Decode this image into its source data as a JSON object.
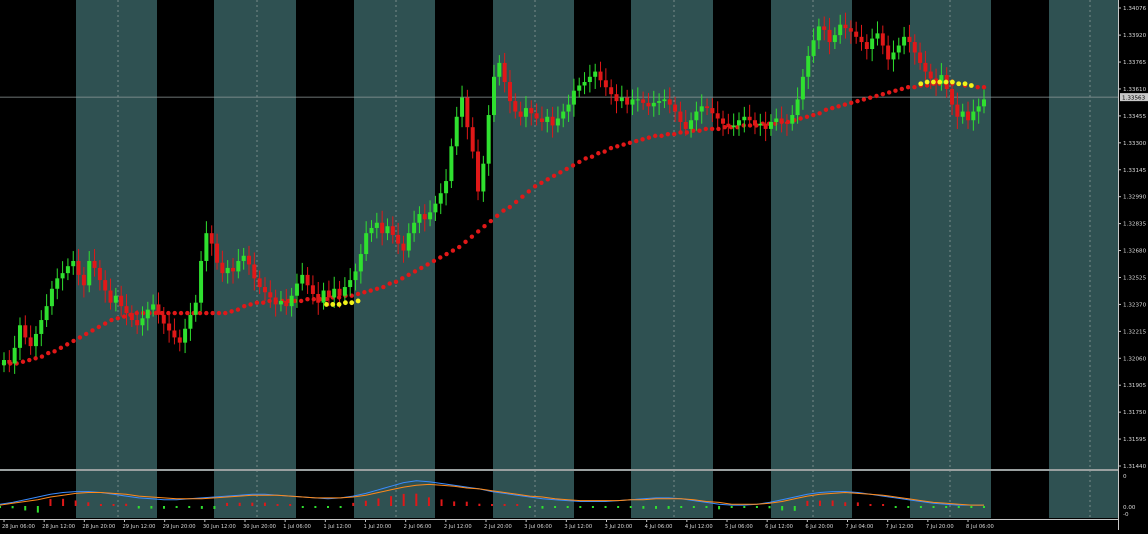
{
  "chart_data": {
    "type": "candlestick",
    "symbol_hint": "GBP/USD style FX chart",
    "colors": {
      "background": "#000000",
      "session_band": "#2f5152",
      "grid": "#9aa0a0",
      "bull_candle": "#2fe02f",
      "bear_candle": "#e01818",
      "ma_red": "#e01818",
      "ma_yellow": "#f2f21a",
      "price_line": "#8f9a9a",
      "axis_text": "#d8d8d8",
      "current_price_box": "#c8c8c8"
    },
    "price_axis": {
      "ylim": [
        1.3144,
        1.34076
      ],
      "tick_labels": [
        "1.34076",
        "1.33920",
        "1.33765",
        "1.33610",
        "1.33455",
        "1.33300",
        "1.33145",
        "1.32990",
        "1.32835",
        "1.32680",
        "1.32525",
        "1.32370",
        "1.32215",
        "1.32060",
        "1.31905",
        "1.31750",
        "1.31595",
        "1.31440"
      ],
      "tick_values": [
        1.34076,
        1.3392,
        1.33765,
        1.3361,
        1.33455,
        1.333,
        1.33145,
        1.3299,
        1.32835,
        1.3268,
        1.32525,
        1.3237,
        1.32215,
        1.3206,
        1.31905,
        1.3175,
        1.31595,
        1.3144
      ],
      "current_price": "1.33563"
    },
    "time_axis": {
      "tick_labels": [
        "28 Jun 06:00",
        "28 Jun 12:00",
        "28 Jun 20:00",
        "29 Jun 12:00",
        "29 Jun 20:00",
        "30 Jun 12:00",
        "30 Jun 20:00",
        "1 Jul 06:00",
        "1 Jul 12:00",
        "1 Jul 20:00",
        "2 Jul 06:00",
        "2 Jul 12:00",
        "2 Jul 20:00",
        "3 Jul 06:00",
        "3 Jul 12:00",
        "3 Jul 20:00",
        "4 Jul 06:00",
        "4 Jul 12:00",
        "5 Jul 06:00",
        "6 Jul 12:00",
        "6 Jul 20:00",
        "7 Jul 04:00",
        "7 Jul 12:00",
        "7 Jul 20:00",
        "8 Jul 06:00"
      ]
    },
    "indicator_axis": {
      "tick_labels": [
        "0",
        "0.00",
        "-0"
      ]
    },
    "candles_close": [
      1.3205,
      1.3203,
      1.3212,
      1.3225,
      1.3218,
      1.3213,
      1.322,
      1.3228,
      1.3236,
      1.3246,
      1.3252,
      1.3255,
      1.3259,
      1.3262,
      1.3254,
      1.3248,
      1.3262,
      1.3258,
      1.3251,
      1.3245,
      1.3238,
      1.3242,
      1.3236,
      1.3232,
      1.3228,
      1.3225,
      1.3229,
      1.3234,
      1.3237,
      1.3231,
      1.3226,
      1.3222,
      1.3218,
      1.3215,
      1.3223,
      1.3231,
      1.3238,
      1.3262,
      1.3278,
      1.3272,
      1.3261,
      1.3255,
      1.3258,
      1.3256,
      1.3262,
      1.3265,
      1.326,
      1.3252,
      1.3247,
      1.3244,
      1.3241,
      1.3237,
      1.3239,
      1.3236,
      1.3242,
      1.3249,
      1.3254,
      1.3248,
      1.3243,
      1.3238,
      1.3245,
      1.3241,
      1.3246,
      1.3242,
      1.3247,
      1.3251,
      1.3256,
      1.3266,
      1.3278,
      1.3281,
      1.3284,
      1.3278,
      1.3282,
      1.3277,
      1.3272,
      1.3268,
      1.3278,
      1.3284,
      1.3289,
      1.3286,
      1.329,
      1.3295,
      1.3301,
      1.3308,
      1.3328,
      1.3345,
      1.3356,
      1.3339,
      1.3325,
      1.3302,
      1.3318,
      1.3346,
      1.3368,
      1.3376,
      1.3365,
      1.3354,
      1.3348,
      1.3345,
      1.335,
      1.3347,
      1.3344,
      1.3342,
      1.3345,
      1.334,
      1.3344,
      1.3348,
      1.3352,
      1.336,
      1.3363,
      1.3365,
      1.3368,
      1.3371,
      1.3366,
      1.3362,
      1.3358,
      1.3354,
      1.3356,
      1.3352,
      1.3355,
      1.3355,
      1.3353,
      1.3351,
      1.3353,
      1.3354,
      1.3355,
      1.3352,
      1.3348,
      1.3342,
      1.3338,
      1.3343,
      1.3348,
      1.3351,
      1.335,
      1.3347,
      1.3344,
      1.3341,
      1.3339,
      1.334,
      1.3343,
      1.3345,
      1.3343,
      1.334,
      1.3341,
      1.3338,
      1.3342,
      1.3344,
      1.3342,
      1.3341,
      1.3346,
      1.3355,
      1.3368,
      1.338,
      1.3389,
      1.3397,
      1.3395,
      1.3388,
      1.3392,
      1.3398,
      1.3396,
      1.3394,
      1.3391,
      1.3388,
      1.3384,
      1.339,
      1.3393,
      1.3386,
      1.3378,
      1.3382,
      1.3386,
      1.3391,
      1.3388,
      1.3382,
      1.3376,
      1.3371,
      1.3367,
      1.3364,
      1.3369,
      1.3361,
      1.3352,
      1.3345,
      1.3348,
      1.3343,
      1.3348,
      1.3351,
      1.3355
    ],
    "ma_red": [
      1.3203,
      1.3203,
      1.3203,
      1.3204,
      1.3205,
      1.3206,
      1.3207,
      1.3209,
      1.321,
      1.3212,
      1.3214,
      1.3216,
      1.3218,
      1.322,
      1.3222,
      1.3224,
      1.3226,
      1.3228,
      1.3229,
      1.323,
      1.3231,
      1.3232,
      1.3232,
      1.3232,
      1.3232,
      1.3232,
      1.3232,
      1.3232,
      1.3232,
      1.3232,
      1.3232,
      1.3232,
      1.3232,
      1.3232,
      1.3232,
      1.3232,
      1.3233,
      1.3234,
      1.3236,
      1.3237,
      1.3238,
      1.3238,
      1.3239,
      1.3239,
      1.3239,
      1.3239,
      1.3239,
      1.3239,
      1.324,
      1.324,
      1.324,
      1.324,
      1.3241,
      1.3241,
      1.3242,
      1.3242,
      1.3243,
      1.3244,
      1.3245,
      1.3246,
      1.3247,
      1.3249,
      1.325,
      1.3252,
      1.3254,
      1.3256,
      1.3258,
      1.326,
      1.3262,
      1.3264,
      1.3266,
      1.3268,
      1.327,
      1.3273,
      1.3276,
      1.3279,
      1.3282,
      1.3285,
      1.3288,
      1.3291,
      1.3293,
      1.3296,
      1.3299,
      1.3302,
      1.3305,
      1.3307,
      1.3309,
      1.3311,
      1.3313,
      1.3315,
      1.3317,
      1.3319,
      1.3321,
      1.3322,
      1.3324,
      1.3325,
      1.3327,
      1.3328,
      1.3329,
      1.333,
      1.3331,
      1.3332,
      1.3333,
      1.3334,
      1.3334,
      1.3335,
      1.3335,
      1.3336,
      1.3336,
      1.3337,
      1.3337,
      1.3338,
      1.3338,
      1.3338,
      1.3339,
      1.3339,
      1.3339,
      1.334,
      1.334,
      1.334,
      1.3341,
      1.3341,
      1.3341,
      1.3342,
      1.3342,
      1.3343,
      1.3344,
      1.3345,
      1.3346,
      1.3347,
      1.3349,
      1.335,
      1.3351,
      1.3352,
      1.3353,
      1.3354,
      1.3355,
      1.3356,
      1.3357,
      1.3358,
      1.3359,
      1.336,
      1.3361,
      1.3362,
      1.3362,
      1.3363,
      1.3363,
      1.3364,
      1.3364,
      1.3364,
      1.3364,
      1.3364,
      1.3363,
      1.3363,
      1.3362,
      1.3362
    ],
    "ma_yellow_segments": [
      {
        "start": 51,
        "values": [
          1.3237,
          1.3237,
          1.3237,
          1.3238,
          1.3238,
          1.3239
        ]
      },
      {
        "start": 145,
        "values": [
          1.3364,
          1.3365,
          1.3365,
          1.3365,
          1.3365,
          1.3365,
          1.3364,
          1.3364,
          1.3363
        ]
      }
    ],
    "macd_line": [
      0.2,
      0.4,
      0.7,
      1.0,
      1.3,
      1.5,
      1.6,
      1.6,
      1.5,
      1.3,
      1.1,
      0.9,
      0.8,
      0.7,
      0.7,
      0.8,
      0.9,
      1.0,
      1.1,
      1.2,
      1.3,
      1.3,
      1.2,
      1.1,
      1.0,
      0.9,
      0.8,
      0.9,
      1.1,
      1.4,
      1.8,
      2.2,
      2.6,
      2.8,
      2.7,
      2.5,
      2.3,
      2.1,
      1.9,
      1.6,
      1.4,
      1.2,
      1.0,
      0.8,
      0.7,
      0.6,
      0.5,
      0.5,
      0.5,
      0.6,
      0.7,
      0.8,
      0.9,
      0.9,
      0.8,
      0.6,
      0.4,
      0.2,
      0.1,
      0.1,
      0.2,
      0.4,
      0.7,
      1.0,
      1.3,
      1.5,
      1.6,
      1.6,
      1.5,
      1.3,
      1.1,
      0.9,
      0.7,
      0.5,
      0.3,
      0.2,
      0.1,
      0.1,
      0.1
    ],
    "signal_line": [
      0.1,
      0.3,
      0.5,
      0.7,
      1.0,
      1.2,
      1.4,
      1.5,
      1.5,
      1.4,
      1.3,
      1.1,
      1.0,
      0.9,
      0.8,
      0.8,
      0.8,
      0.9,
      1.0,
      1.1,
      1.2,
      1.2,
      1.2,
      1.1,
      1.0,
      0.9,
      0.9,
      0.9,
      1.0,
      1.2,
      1.5,
      1.8,
      2.1,
      2.3,
      2.4,
      2.3,
      2.2,
      2.0,
      1.9,
      1.7,
      1.5,
      1.3,
      1.1,
      1.0,
      0.8,
      0.7,
      0.6,
      0.6,
      0.6,
      0.6,
      0.7,
      0.7,
      0.8,
      0.8,
      0.8,
      0.7,
      0.5,
      0.4,
      0.2,
      0.2,
      0.2,
      0.3,
      0.5,
      0.8,
      1.1,
      1.3,
      1.4,
      1.5,
      1.4,
      1.3,
      1.2,
      1.0,
      0.8,
      0.6,
      0.4,
      0.3,
      0.2,
      0.1,
      0.1
    ],
    "grid": true,
    "legend": "none"
  }
}
